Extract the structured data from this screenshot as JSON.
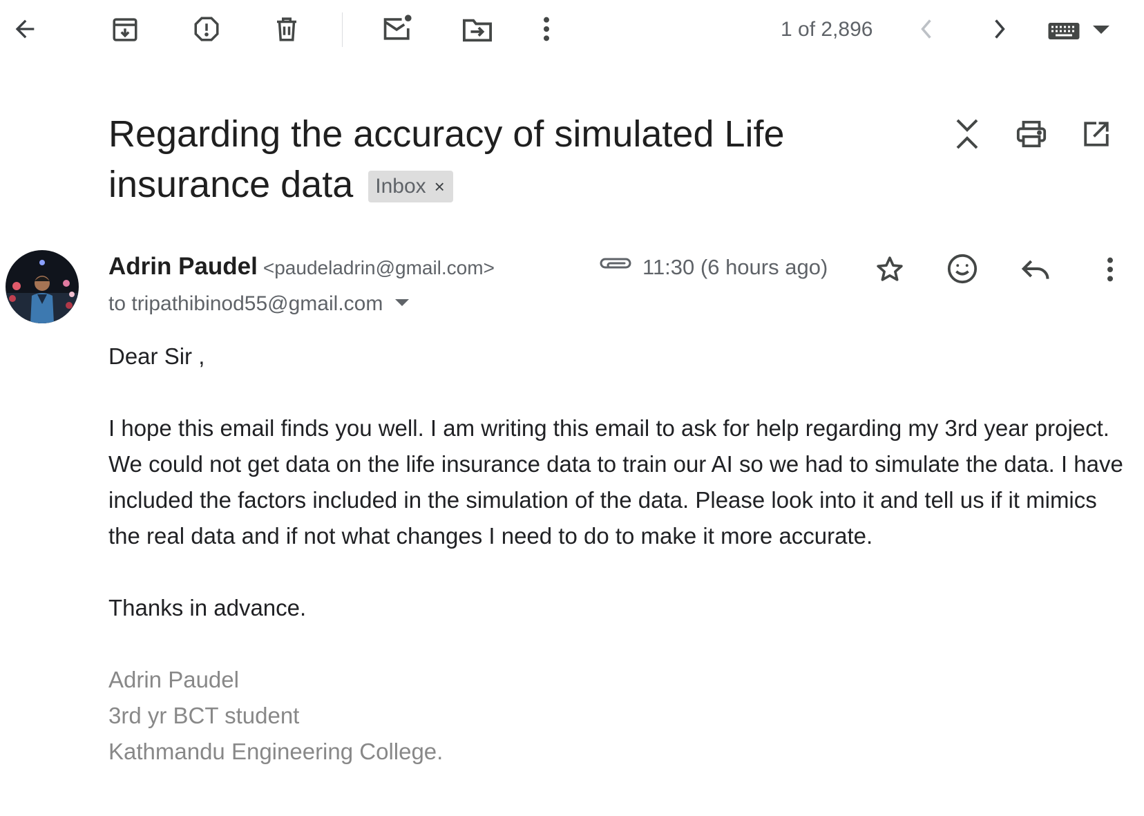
{
  "toolbar": {
    "icons": [
      "back-arrow-icon",
      "archive-icon",
      "report-spam-icon",
      "delete-icon",
      "mark-unread-icon",
      "move-to-icon",
      "more-vertical-icon"
    ],
    "pager": "1 of 2,896",
    "nav_icons": [
      "chevron-left-icon",
      "chevron-right-icon"
    ],
    "input_tools_icon": "keyboard-icon"
  },
  "header": {
    "subject": "Regarding the accuracy of simulated Life insurance data",
    "label": "Inbox",
    "label_remove": "×",
    "actions": [
      "collapse-all-icon",
      "print-icon",
      "open-new-window-icon"
    ]
  },
  "message": {
    "sender_name": "Adrin Paudel",
    "sender_email": "<paudeladrin@gmail.com>",
    "to": "to tripathibinod55@gmail.com",
    "time": "11:30 (6 hours ago)",
    "has_attachment": true,
    "actions": [
      "star-icon",
      "emoji-reaction-icon",
      "reply-icon",
      "more-vertical-icon"
    ],
    "body": {
      "greeting": "Dear Sir ,",
      "para1": "I hope this email finds you well. I am writing this email to ask for help regarding my 3rd year project.",
      "para2": "We could not get data on the life insurance data to train our AI so we had to simulate the data. I have included the factors included in the simulation of the data. Please look into it and tell us if it mimics the real data and if not what changes I need to do to make it more accurate.",
      "thanks": "Thanks in advance.",
      "signature": [
        "Adrin Paudel",
        "3rd yr BCT student",
        "Kathmandu Engineering College."
      ]
    }
  },
  "colors": {
    "icon": "#5f6368",
    "text": "#202124",
    "label_bg": "#dddddd",
    "signature": "#888888"
  }
}
